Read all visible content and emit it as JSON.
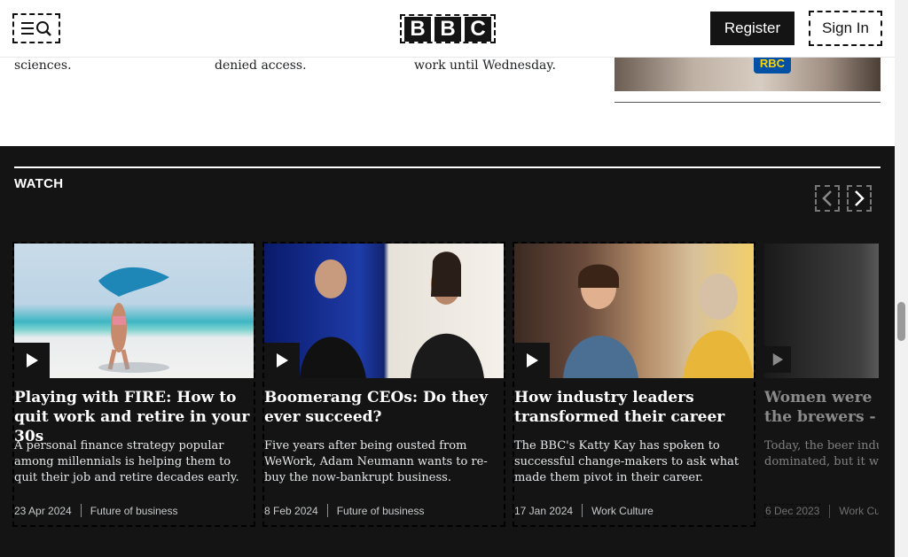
{
  "header": {
    "logo": "BBC",
    "logo_letters": [
      "B",
      "B",
      "C"
    ],
    "register_label": "Register",
    "signin_label": "Sign In",
    "menu_icon": "menu-search-icon"
  },
  "top_tail": {
    "col1": "sciences.",
    "col2": "denied access.",
    "col3": "work until Wednesday.",
    "ad_logo": "RBC"
  },
  "watch": {
    "title": "WATCH",
    "prev_icon": "chevron-left-icon",
    "next_icon": "chevron-right-icon",
    "cards": [
      {
        "headline": "Playing with FIRE: How to quit work and retire in your 30s",
        "description": "A personal finance strategy popular among millennials is helping them to quit their job and retire decades early.",
        "date": "23 Apr 2024",
        "category": "Future of business"
      },
      {
        "headline": "Boomerang CEOs: Do they ever succeed?",
        "description": "Five years after being ousted from WeWork, Adam Neumann wants to re-buy the now-bankrupt business.",
        "date": "8 Feb 2024",
        "category": "Future of business"
      },
      {
        "headline": "How industry leaders transformed their career",
        "description": "The BBC's Katty Kay has spoken to successful change-makers to ask what made them pivot in their career.",
        "date": "17 Jan 2024",
        "category": "Work Culture"
      },
      {
        "headline": "Women were the brewers - what",
        "description": "Today, the beer indu dominated, but it w",
        "date": "6 Dec 2023",
        "category": "Work Cultu"
      }
    ]
  },
  "colors": {
    "watch_bg": "#141414",
    "text_white": "#ffffff",
    "meta_grey": "#c7cacc"
  }
}
